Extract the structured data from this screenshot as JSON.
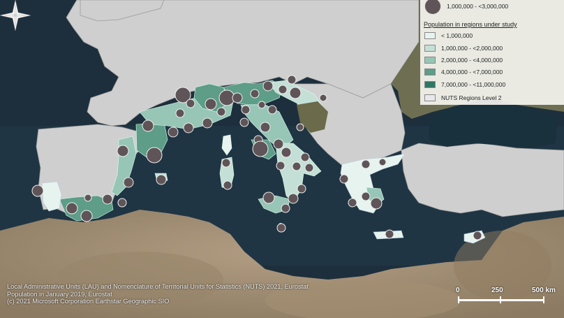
{
  "colors": {
    "sea": "#1d2f3c",
    "land": "#6b6a52",
    "desert": "#a4927a",
    "nonstudy_region": "#cfcfcf",
    "class1": "#e6f3ef",
    "class2": "#c4e0d6",
    "class3": "#97c5b6",
    "class4": "#5e9d88",
    "class5": "#2f7764",
    "city_fill": "#5f5558",
    "city_stroke": "#eeeeee"
  },
  "legend": {
    "city_size_label": "1,000,000 - <3,000,000",
    "title": "Population in regions under study",
    "classes": [
      {
        "label": "< 1,000,000",
        "color": "#e6f3ef"
      },
      {
        "label": "1,000,000 - <2,000,000",
        "color": "#c4e0d6"
      },
      {
        "label": "2,000,000 - <4,000,000",
        "color": "#97c5b6"
      },
      {
        "label": "4,000,000 - <7,000,000",
        "color": "#5e9d88"
      },
      {
        "label": "7,000,000 - <11,000,000",
        "color": "#2f7764"
      }
    ],
    "nuts_label": "NUTS Regions Level 2",
    "nuts_color": "#e8e8ec"
  },
  "credits": {
    "line1": "Local Administrative Units (LAU) and Nomenclature of Territorial Units for Statistics (NUTS) 2021, Eurostat",
    "line2": "Population in January 2019, Eurostat",
    "line3": "(c) 2021 Microsoft Corporation Earthstar Geographic SIO"
  },
  "scale": {
    "label0": "0",
    "label1": "250",
    "label2": "500 km"
  },
  "compass_icon": "north-arrow-compass-icon"
}
